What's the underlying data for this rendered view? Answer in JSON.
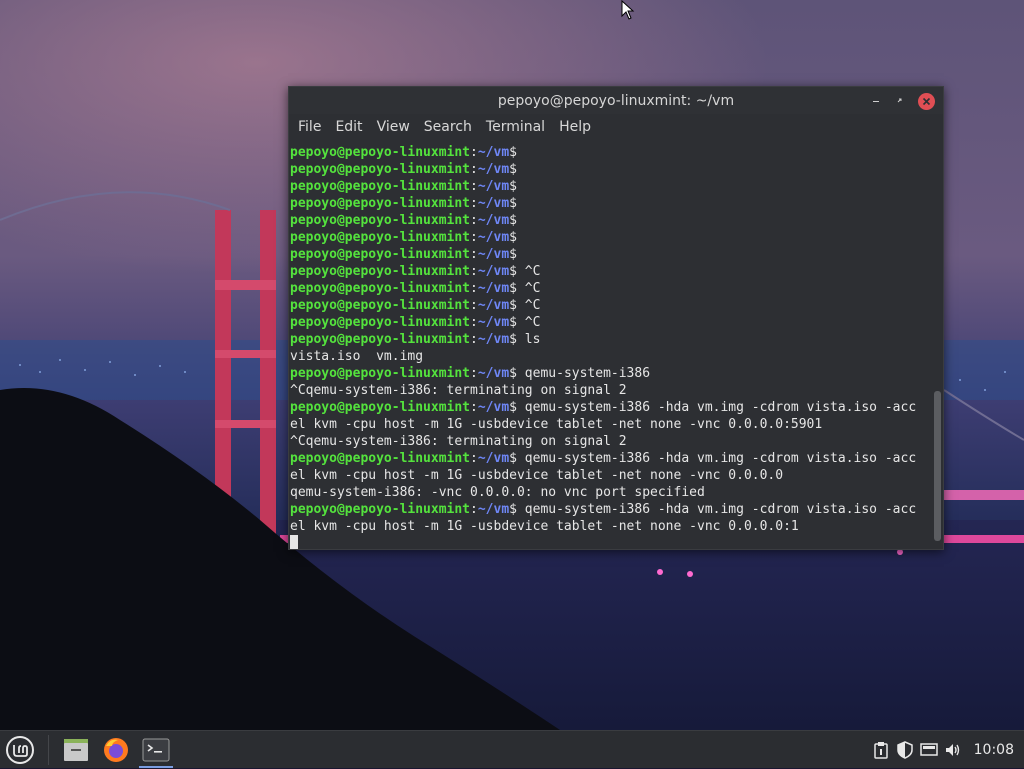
{
  "window": {
    "title": "pepoyo@pepoyo-linuxmint: ~/vm",
    "controls": {
      "minimize": "–",
      "maximize": "⤢",
      "close": "✕"
    }
  },
  "menubar": [
    "File",
    "Edit",
    "View",
    "Search",
    "Terminal",
    "Help"
  ],
  "terminal": {
    "prompt_user": "pepoyo@pepoyo-linuxmint",
    "prompt_path": "~/vm",
    "prompt_sign": "$",
    "lines": [
      {
        "type": "prompt",
        "cmd": ""
      },
      {
        "type": "prompt",
        "cmd": ""
      },
      {
        "type": "prompt",
        "cmd": ""
      },
      {
        "type": "prompt",
        "cmd": ""
      },
      {
        "type": "prompt",
        "cmd": ""
      },
      {
        "type": "prompt",
        "cmd": ""
      },
      {
        "type": "prompt",
        "cmd": ""
      },
      {
        "type": "prompt",
        "cmd": " ^C"
      },
      {
        "type": "prompt",
        "cmd": " ^C"
      },
      {
        "type": "prompt",
        "cmd": " ^C"
      },
      {
        "type": "prompt",
        "cmd": " ^C"
      },
      {
        "type": "prompt",
        "cmd": " ls"
      },
      {
        "type": "output",
        "text": "vista.iso  vm.img"
      },
      {
        "type": "prompt",
        "cmd": " qemu-system-i386"
      },
      {
        "type": "output",
        "text": "^Cqemu-system-i386: terminating on signal 2"
      },
      {
        "type": "prompt",
        "cmd": " qemu-system-i386 -hda vm.img -cdrom vista.iso -acc"
      },
      {
        "type": "output",
        "text": "el kvm -cpu host -m 1G -usbdevice tablet -net none -vnc 0.0.0.0:5901"
      },
      {
        "type": "output",
        "text": "^Cqemu-system-i386: terminating on signal 2"
      },
      {
        "type": "prompt",
        "cmd": " qemu-system-i386 -hda vm.img -cdrom vista.iso -acc"
      },
      {
        "type": "output",
        "text": "el kvm -cpu host -m 1G -usbdevice tablet -net none -vnc 0.0.0.0"
      },
      {
        "type": "output",
        "text": "qemu-system-i386: -vnc 0.0.0.0: no vnc port specified"
      },
      {
        "type": "prompt",
        "cmd": " qemu-system-i386 -hda vm.img -cdrom vista.iso -acc"
      },
      {
        "type": "output",
        "text": "el kvm -cpu host -m 1G -usbdevice tablet -net none -vnc 0.0.0.0:1"
      },
      {
        "type": "cursor"
      }
    ]
  },
  "taskbar": {
    "launchers": [
      "mint-menu-icon",
      "file-manager-icon",
      "firefox-icon",
      "terminal-icon"
    ],
    "tray_icons": [
      "clipboard-icon",
      "shield-update-icon",
      "network-icon",
      "volume-icon"
    ],
    "clock": "10:08"
  },
  "colors": {
    "prompt_user": "#54e33d",
    "prompt_path": "#6e86f5",
    "close_button": "#e04e54",
    "terminal_bg": "#2d2f33",
    "taskbar_bg": "#2b2d31"
  }
}
